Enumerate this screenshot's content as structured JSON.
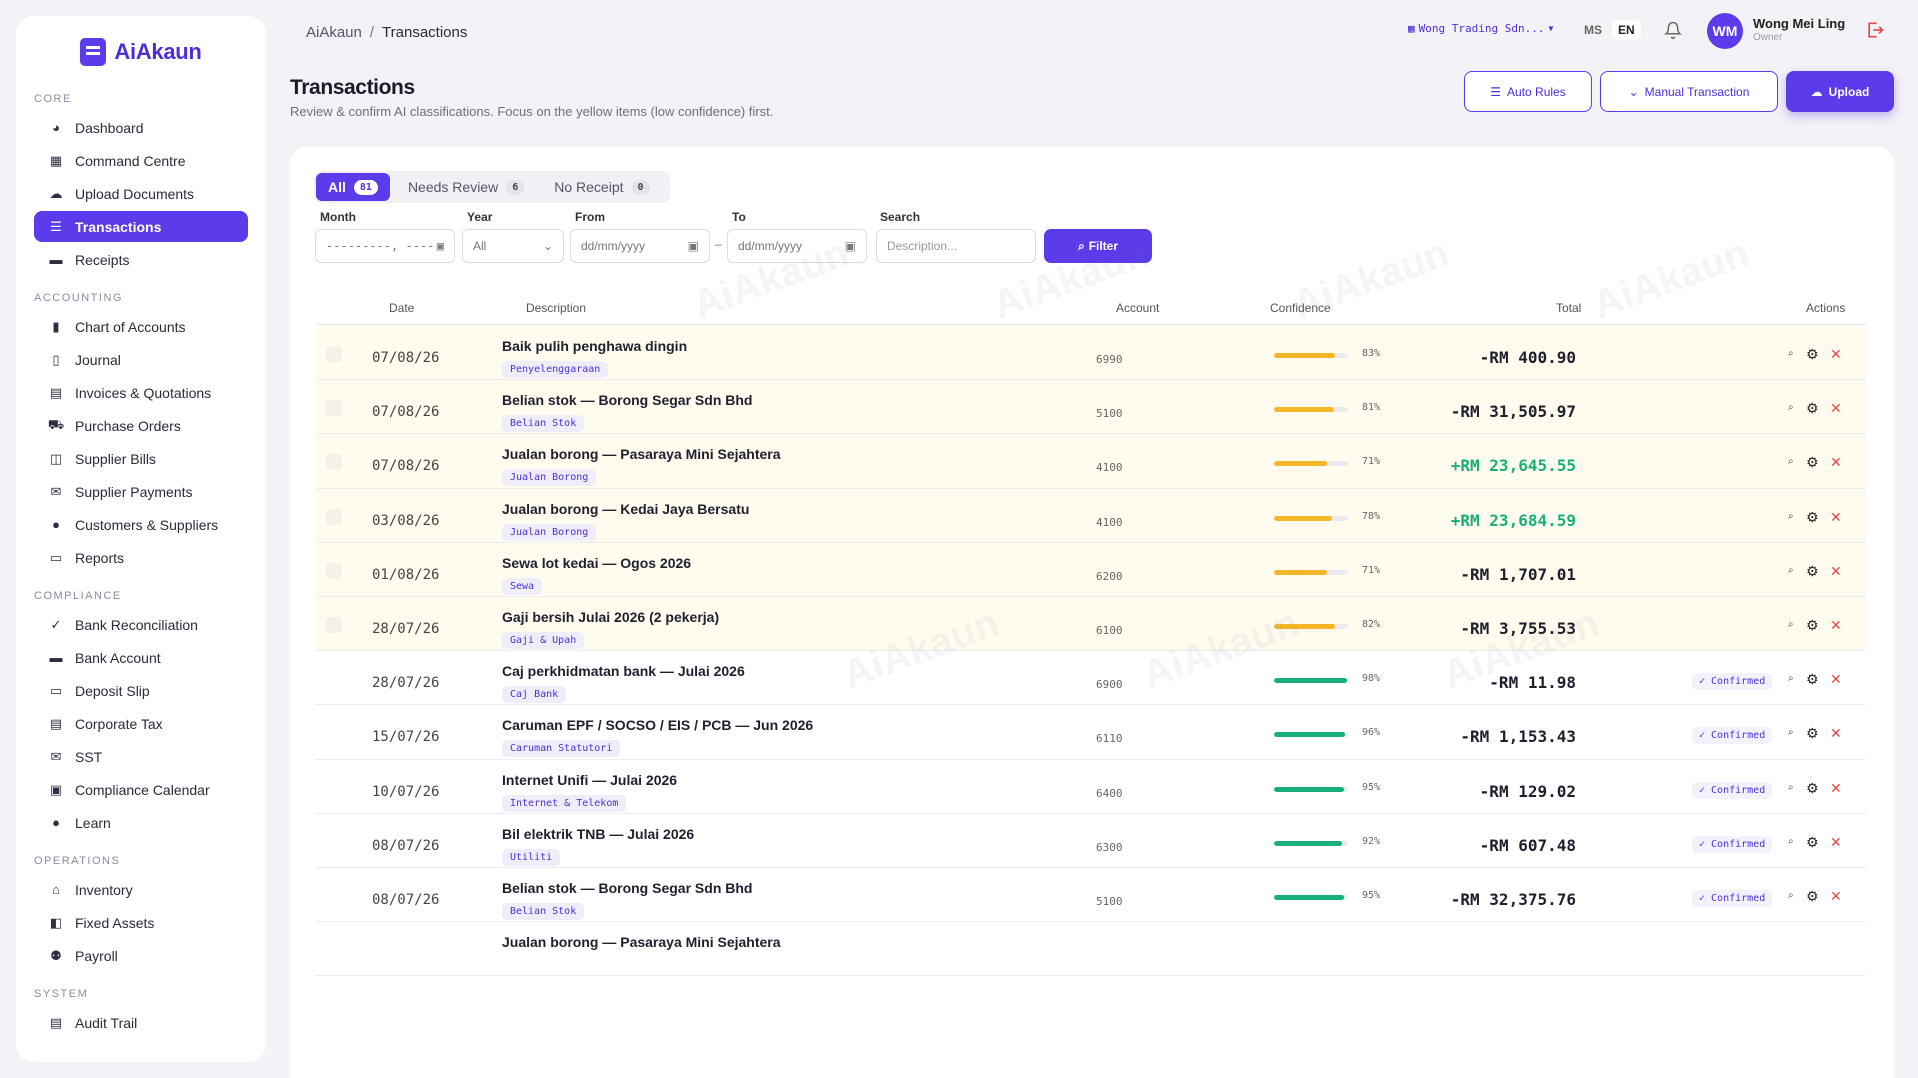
{
  "app": {
    "name": "AiAkaun"
  },
  "sidebar": {
    "sections": [
      {
        "title": "CORE",
        "items": [
          {
            "label": "Dashboard",
            "icon": "chart-pie-icon"
          },
          {
            "label": "Command Centre",
            "icon": "grid-icon"
          },
          {
            "label": "Upload Documents",
            "icon": "cloud-upload-icon"
          },
          {
            "label": "Transactions",
            "icon": "list-icon",
            "active": true
          },
          {
            "label": "Receipts",
            "icon": "briefcase-icon"
          }
        ]
      },
      {
        "title": "ACCOUNTING",
        "items": [
          {
            "label": "Chart of Accounts",
            "icon": "bar-chart-icon"
          },
          {
            "label": "Journal",
            "icon": "book-icon"
          },
          {
            "label": "Invoices & Quotations",
            "icon": "file-icon"
          },
          {
            "label": "Purchase Orders",
            "icon": "cart-icon"
          },
          {
            "label": "Supplier Bills",
            "icon": "cube-icon"
          },
          {
            "label": "Supplier Payments",
            "icon": "envelope-icon"
          },
          {
            "label": "Customers & Suppliers",
            "icon": "user-icon"
          },
          {
            "label": "Reports",
            "icon": "inbox-icon"
          }
        ]
      },
      {
        "title": "COMPLIANCE",
        "items": [
          {
            "label": "Bank Reconciliation",
            "icon": "check-icon"
          },
          {
            "label": "Bank Account",
            "icon": "card-icon"
          },
          {
            "label": "Deposit Slip",
            "icon": "inbox-icon"
          },
          {
            "label": "Corporate Tax",
            "icon": "file-icon"
          },
          {
            "label": "SST",
            "icon": "envelope-icon"
          },
          {
            "label": "Compliance Calendar",
            "icon": "calendar-icon"
          },
          {
            "label": "Learn",
            "icon": "info-icon"
          }
        ]
      },
      {
        "title": "OPERATIONS",
        "items": [
          {
            "label": "Inventory",
            "icon": "bank-icon"
          },
          {
            "label": "Fixed Assets",
            "icon": "box-icon"
          },
          {
            "label": "Payroll",
            "icon": "users-icon"
          }
        ]
      },
      {
        "title": "SYSTEM",
        "items": [
          {
            "label": "Audit Trail",
            "icon": "file-icon"
          }
        ]
      }
    ]
  },
  "header": {
    "breadcrumb_root": "AiAkaun",
    "breadcrumb_sep": "/",
    "breadcrumb_current": "Transactions",
    "company": "Wong Trading Sdn...",
    "lang_ms": "MS",
    "lang_en": "EN",
    "avatar_initials": "WM",
    "user_name": "Wong Mei Ling",
    "user_role": "Owner"
  },
  "page": {
    "title": "Transactions",
    "subtitle": "Review & confirm AI classifications. Focus on the yellow items (low confidence) first.",
    "auto_rules": "Auto Rules",
    "manual_transaction": "Manual Transaction",
    "upload": "Upload"
  },
  "tabs": [
    {
      "label": "All",
      "count": "81",
      "active": true
    },
    {
      "label": "Needs Review",
      "count": "6"
    },
    {
      "label": "No Receipt",
      "count": "0"
    }
  ],
  "filters": {
    "month_label": "Month",
    "month_value": "---------, ----",
    "year_label": "Year",
    "year_value": "All",
    "from_label": "From",
    "from_placeholder": "dd/mm/yyyy",
    "range_sep": "–",
    "to_label": "To",
    "to_placeholder": "dd/mm/yyyy",
    "search_label": "Search",
    "search_placeholder": "Description...",
    "filter_button": "Filter"
  },
  "table": {
    "headers": {
      "date": "Date",
      "description": "Description",
      "account": "Account",
      "confidence": "Confidence",
      "total": "Total",
      "actions": "Actions"
    },
    "confirmed_label": "✓ Confirmed",
    "rows": [
      {
        "date": "07/08/26",
        "description": "Baik pulih penghawa dingin",
        "tag": "Penyelenggaraan",
        "account": "6990",
        "confidence": 83,
        "confidence_text": "83%",
        "total": "-RM 400.90",
        "positive": false,
        "confirmed": false
      },
      {
        "date": "07/08/26",
        "description": "Belian stok — Borong Segar Sdn Bhd",
        "tag": "Belian Stok",
        "account": "5100",
        "confidence": 81,
        "confidence_text": "81%",
        "total": "-RM 31,505.97",
        "positive": false,
        "confirmed": false
      },
      {
        "date": "07/08/26",
        "description": "Jualan borong — Pasaraya Mini Sejahtera",
        "tag": "Jualan Borong",
        "account": "4100",
        "confidence": 71,
        "confidence_text": "71%",
        "total": "+RM 23,645.55",
        "positive": true,
        "confirmed": false
      },
      {
        "date": "03/08/26",
        "description": "Jualan borong — Kedai Jaya Bersatu",
        "tag": "Jualan Borong",
        "account": "4100",
        "confidence": 78,
        "confidence_text": "78%",
        "total": "+RM 23,684.59",
        "positive": true,
        "confirmed": false
      },
      {
        "date": "01/08/26",
        "description": "Sewa lot kedai — Ogos 2026",
        "tag": "Sewa",
        "account": "6200",
        "confidence": 71,
        "confidence_text": "71%",
        "total": "-RM 1,707.01",
        "positive": false,
        "confirmed": false
      },
      {
        "date": "28/07/26",
        "description": "Gaji bersih Julai 2026 (2 pekerja)",
        "tag": "Gaji & Upah",
        "account": "6100",
        "confidence": 82,
        "confidence_text": "82%",
        "total": "-RM 3,755.53",
        "positive": false,
        "confirmed": false
      },
      {
        "date": "28/07/26",
        "description": "Caj perkhidmatan bank — Julai 2026",
        "tag": "Caj Bank",
        "account": "6900",
        "confidence": 98,
        "confidence_text": "98%",
        "total": "-RM 11.98",
        "positive": false,
        "confirmed": true
      },
      {
        "date": "15/07/26",
        "description": "Caruman EPF / SOCSO / EIS / PCB — Jun 2026",
        "tag": "Caruman Statutori",
        "account": "6110",
        "confidence": 96,
        "confidence_text": "96%",
        "total": "-RM 1,153.43",
        "positive": false,
        "confirmed": true
      },
      {
        "date": "10/07/26",
        "description": "Internet Unifi — Julai 2026",
        "tag": "Internet & Telekom",
        "account": "6400",
        "confidence": 95,
        "confidence_text": "95%",
        "total": "-RM 129.02",
        "positive": false,
        "confirmed": true
      },
      {
        "date": "08/07/26",
        "description": "Bil elektrik TNB — Julai 2026",
        "tag": "Utiliti",
        "account": "6300",
        "confidence": 92,
        "confidence_text": "92%",
        "total": "-RM 607.48",
        "positive": false,
        "confirmed": true
      },
      {
        "date": "08/07/26",
        "description": "Belian stok — Borong Segar Sdn Bhd",
        "tag": "Belian Stok",
        "account": "5100",
        "confidence": 95,
        "confidence_text": "95%",
        "total": "-RM 32,375.76",
        "positive": false,
        "confirmed": true
      },
      {
        "date": "",
        "description": "Jualan borong — Pasaraya Mini Sejahtera",
        "tag": "",
        "account": "",
        "confidence": 0,
        "confidence_text": "",
        "total": "",
        "positive": false,
        "confirmed": false,
        "partial": true
      }
    ]
  },
  "colors": {
    "accent": "#5b3bea",
    "low_conf": "#f5b728",
    "high_conf": "#17b07a",
    "negative": "#1f1f2e",
    "positive": "#17b07a",
    "low_row_bg": "#fffbef"
  }
}
